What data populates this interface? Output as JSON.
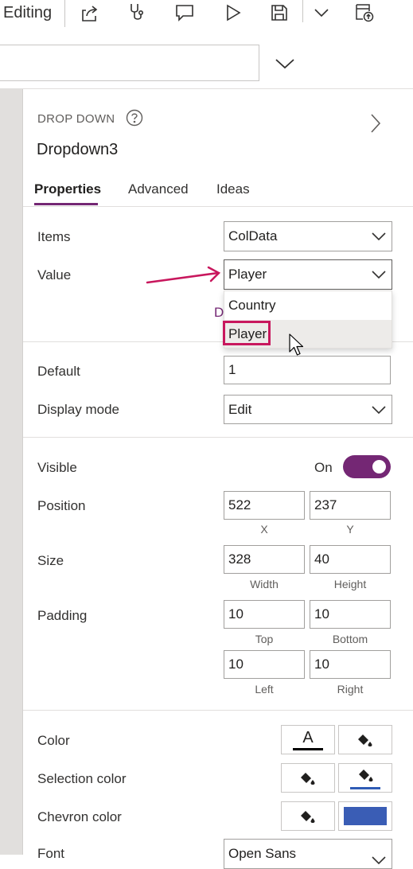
{
  "toolbar": {
    "mode_label": "Editing"
  },
  "panel": {
    "control_type": "DROP DOWN",
    "control_name": "Dropdown3",
    "tabs": {
      "properties": "Properties",
      "advanced": "Advanced",
      "ideas": "Ideas"
    },
    "items": {
      "label": "Items",
      "value": "ColData"
    },
    "value": {
      "label": "Value",
      "value": "Player",
      "options": [
        "Country",
        "Player"
      ],
      "hidden_text": "D"
    },
    "default": {
      "label": "Default",
      "value": "1"
    },
    "display_mode": {
      "label": "Display mode",
      "value": "Edit"
    },
    "visible": {
      "label": "Visible",
      "state": "On"
    },
    "position": {
      "label": "Position",
      "x": "522",
      "y": "237",
      "x_label": "X",
      "y_label": "Y"
    },
    "size": {
      "label": "Size",
      "width": "328",
      "height": "40",
      "width_label": "Width",
      "height_label": "Height"
    },
    "padding": {
      "label": "Padding",
      "top": "10",
      "bottom": "10",
      "left": "10",
      "right": "10",
      "top_label": "Top",
      "bottom_label": "Bottom",
      "left_label": "Left",
      "right_label": "Right"
    },
    "color": {
      "label": "Color",
      "glyph": "A"
    },
    "selection_color": {
      "label": "Selection color"
    },
    "chevron_color": {
      "label": "Chevron color"
    },
    "font": {
      "label": "Font",
      "value": "Open Sans"
    }
  },
  "colors": {
    "accent": "#742774",
    "annotation": "#c8175d",
    "chevron_fill": "#3a5db5",
    "selection_underline": "#2f5cb5"
  }
}
